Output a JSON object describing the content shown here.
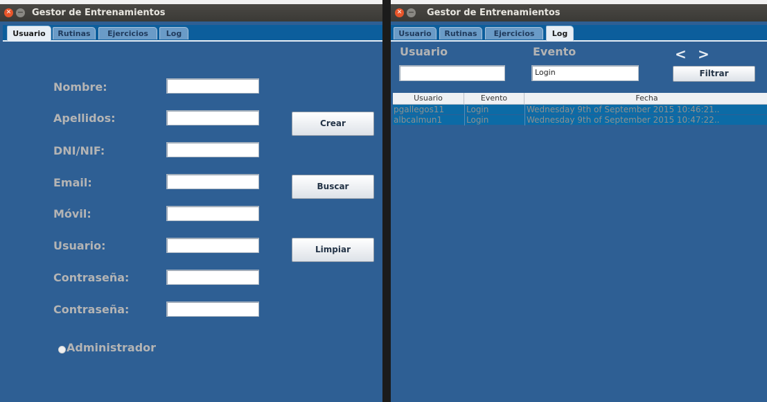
{
  "left_window": {
    "title": "Gestor de Entrenamientos",
    "tabs": [
      "Usuario",
      "Rutinas",
      "Ejercicios",
      "Log"
    ],
    "active_tab": "Usuario",
    "fields": [
      {
        "label": "Nombre:",
        "value": ""
      },
      {
        "label": "Apellidos:",
        "value": ""
      },
      {
        "label": "DNI/NIF:",
        "value": ""
      },
      {
        "label": "Email:",
        "value": ""
      },
      {
        "label": "Móvil:",
        "value": ""
      },
      {
        "label": "Usuario:",
        "value": ""
      },
      {
        "label": "Contraseña:",
        "value": ""
      },
      {
        "label": "Contraseña:",
        "value": ""
      }
    ],
    "buttons": {
      "create": "Crear",
      "search": "Buscar",
      "clear": "Limpiar"
    },
    "admin_radio": {
      "label": "Administrador",
      "checked": false
    }
  },
  "right_window": {
    "title": "Gestor de Entrenamientos",
    "tabs": [
      "Usuario",
      "Rutinas",
      "Ejercicios",
      "Log"
    ],
    "active_tab": "Log",
    "filter": {
      "user_label": "Usuario",
      "event_label": "Evento",
      "user_value": "",
      "event_value": "Login",
      "filter_button": "Filtrar",
      "prev": "<",
      "next": ">"
    },
    "table": {
      "columns": [
        "Usuario",
        "Evento",
        "Fecha"
      ],
      "rows": [
        {
          "usuario": "pgallegos11",
          "evento": "Login",
          "fecha": "Wednesday 9th of September 2015 10:46:21.."
        },
        {
          "usuario": "albcalmun1",
          "evento": "Login",
          "fecha": "Wednesday 9th of September 2015 10:47:22.."
        }
      ]
    }
  },
  "colors": {
    "panel_bg": "#2e5f94",
    "tab_bar": "#0c5e9c",
    "selected_row": "#0c6ba6",
    "label_text": "#b4b4b4"
  }
}
